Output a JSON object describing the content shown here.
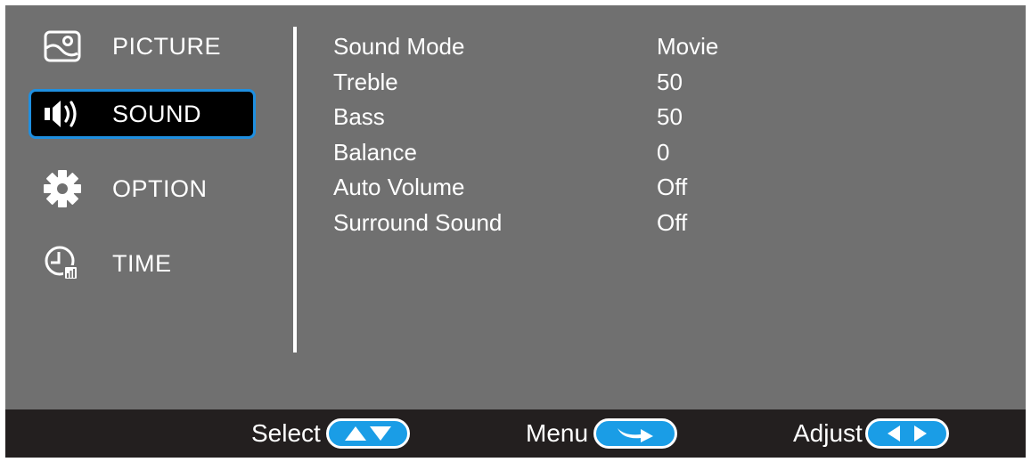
{
  "menu": {
    "items": [
      {
        "label": "PICTURE",
        "icon": "picture-icon",
        "selected": false
      },
      {
        "label": "SOUND",
        "icon": "speaker-icon",
        "selected": true
      },
      {
        "label": "OPTION",
        "icon": "gear-icon",
        "selected": false
      },
      {
        "label": "TIME",
        "icon": "clock-icon",
        "selected": false
      }
    ]
  },
  "settings": [
    {
      "name": "Sound Mode",
      "value": "Movie"
    },
    {
      "name": "Treble",
      "value": "50"
    },
    {
      "name": "Bass",
      "value": "50"
    },
    {
      "name": "Balance",
      "value": "0"
    },
    {
      "name": "Auto Volume",
      "value": "Off"
    },
    {
      "name": "Surround Sound",
      "value": "Off"
    }
  ],
  "bottom_bar": {
    "select_label": "Select",
    "select_icon": "up-down-arrows-icon",
    "menu_label": "Menu",
    "menu_icon": "return-arrow-icon",
    "adjust_label": "Adjust",
    "adjust_icon": "left-right-arrows-icon"
  },
  "colors": {
    "background": "#707070",
    "selection_border": "#1f8fe0",
    "selection_fill": "#000000",
    "bottom_bar": "#231f1f",
    "pill_fill": "#1a9de6",
    "text": "#ffffff"
  }
}
